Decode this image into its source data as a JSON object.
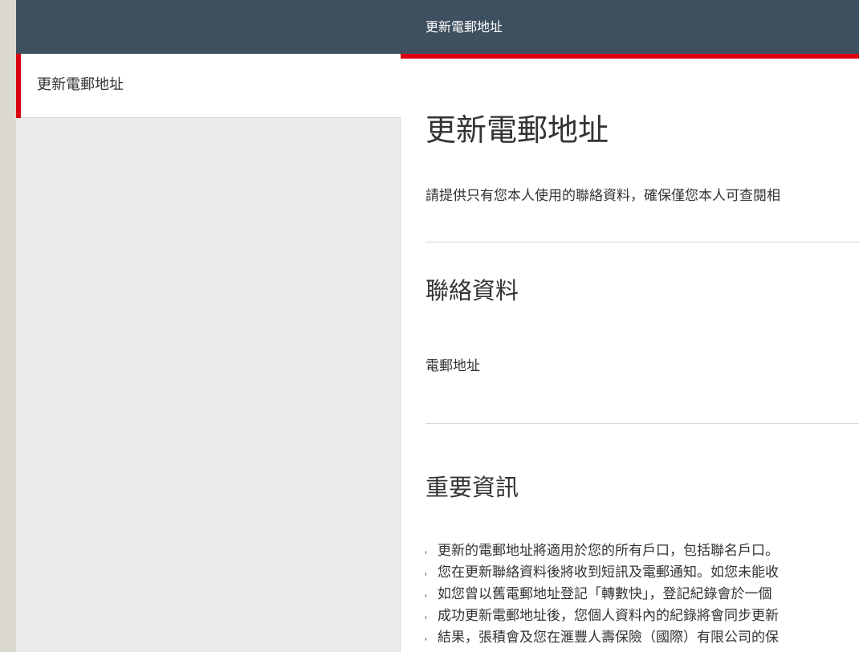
{
  "header": {
    "title": "更新電郵地址"
  },
  "sidebar": {
    "items": [
      {
        "label": "更新電郵地址",
        "active": true
      }
    ]
  },
  "main": {
    "heading": "更新電郵地址",
    "intro": "請提供只有您本人使用的聯絡資料，確保僅您本人可查閱相",
    "contact_section": {
      "heading": "聯絡資料",
      "field_label": "電郵地址"
    },
    "important_section": {
      "heading": "重要資訊",
      "bullets": [
        "更新的電郵地址將適用於您的所有戶口，包括聯名戶口。",
        "您在更新聯絡資料後將收到短訊及電郵通知。如您未能收",
        "如您曾以舊電郵地址登記「轉數快」，登記紀錄會於一個",
        "成功更新電郵地址後，您個人資料內的紀錄將會同步更新",
        "結果，張積會及您在滙豐人壽保險（國際）有限公司的保"
      ]
    }
  },
  "colors": {
    "header_bg": "#3e505f",
    "accent_red": "#db0011",
    "sidebar_bg": "#ebebeb"
  }
}
